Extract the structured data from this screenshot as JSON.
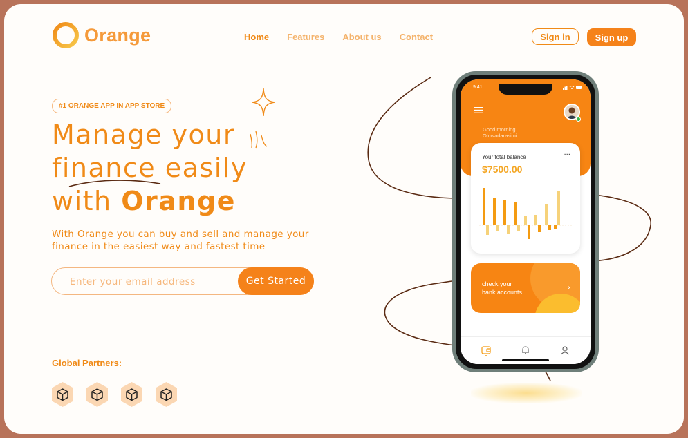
{
  "brand": {
    "name": "Orange",
    "accent": "#f5821a"
  },
  "nav": {
    "items": [
      {
        "label": "Home",
        "active": true
      },
      {
        "label": "Features",
        "active": false
      },
      {
        "label": "About us",
        "active": false
      },
      {
        "label": "Contact",
        "active": false
      }
    ]
  },
  "auth": {
    "signin": "Sign in",
    "signup": "Sign up"
  },
  "hero": {
    "badge": "#1 ORANGE APP IN APP STORE",
    "line1": "Manage your",
    "line2": "finance easily",
    "line3_prefix": "with",
    "line3_brand": "Orange",
    "description": "With Orange you can buy and sell and manage your finance in the easiest way and fastest time",
    "email_placeholder": "Enter your email address",
    "cta": "Get Started"
  },
  "partners": {
    "label": "Global Partners:",
    "count": 4,
    "icon": "cube-icon"
  },
  "phone": {
    "time": "9:41",
    "greeting_line1": "Good morning",
    "greeting_line2": "Oluwadarasimi",
    "balance_label": "Your total balance",
    "balance_menu": "···",
    "balance_amount": "$7500.00",
    "check_line1": "check your",
    "check_line2": "bank accounts",
    "check_arrow": "›",
    "tabs": [
      "wallet-icon",
      "bell-icon",
      "user-icon"
    ]
  }
}
